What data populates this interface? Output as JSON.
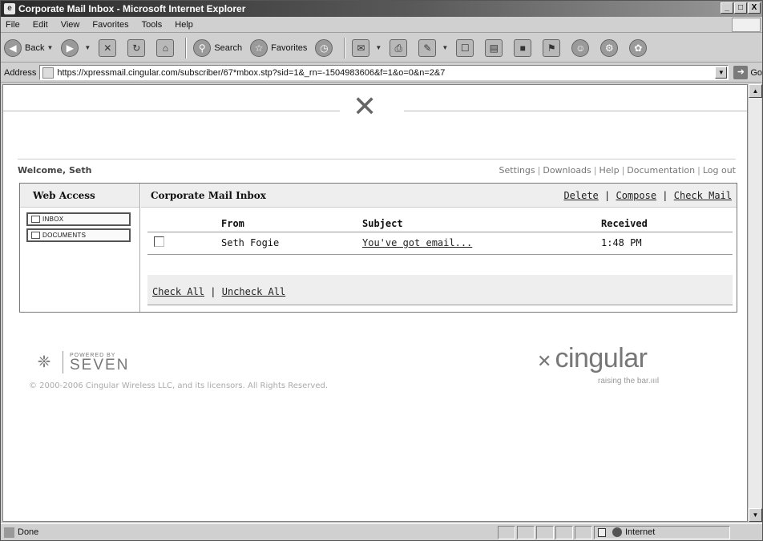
{
  "window": {
    "title": "Corporate Mail Inbox - Microsoft Internet Explorer",
    "min": "_",
    "max": "□",
    "close": "X"
  },
  "menu": [
    "File",
    "Edit",
    "View",
    "Favorites",
    "Tools",
    "Help"
  ],
  "toolbar": {
    "back": "Back",
    "search": "Search",
    "favorites": "Favorites"
  },
  "address": {
    "label": "Address",
    "url": "https://xpressmail.cingular.com/subscriber/67*mbox.stp?sid=1&_rn=-1504983606&f=1&o=0&n=2&7",
    "go": "Go"
  },
  "header": {
    "welcome": "Welcome, Seth",
    "links": [
      "Settings",
      "Downloads",
      "Help",
      "Documentation",
      "Log out"
    ]
  },
  "sidebar": {
    "title": "Web Access",
    "items": [
      "INBOX",
      "DOCUMENTS"
    ]
  },
  "inbox": {
    "title": "Corporate Mail Inbox",
    "actions": [
      "Delete",
      "Compose",
      "Check Mail"
    ],
    "columns": {
      "from": "From",
      "subject": "Subject",
      "received": "Received"
    },
    "rows": [
      {
        "from": "Seth Fogie",
        "subject": "You've got email...",
        "received": "1:48 PM",
        "checked": false
      }
    ],
    "check_all": "Check All",
    "uncheck_all": "Uncheck All"
  },
  "footer": {
    "powered_small": "POWERED BY",
    "powered_big": "SEVEN",
    "copyright": "© 2000-2006 Cingular Wireless LLC, and its licensors. All Rights Reserved.",
    "brand": "cingular",
    "tagline": "raising the bar.ıııl"
  },
  "status": {
    "text": "Done",
    "zone": "Internet"
  },
  "icons": {
    "back": "back-arrow-icon",
    "forward": "forward-arrow-icon",
    "stop": "stop-icon",
    "refresh": "refresh-icon",
    "home": "home-icon",
    "search": "search-icon",
    "favorites": "favorites-star-icon",
    "history": "history-icon"
  }
}
